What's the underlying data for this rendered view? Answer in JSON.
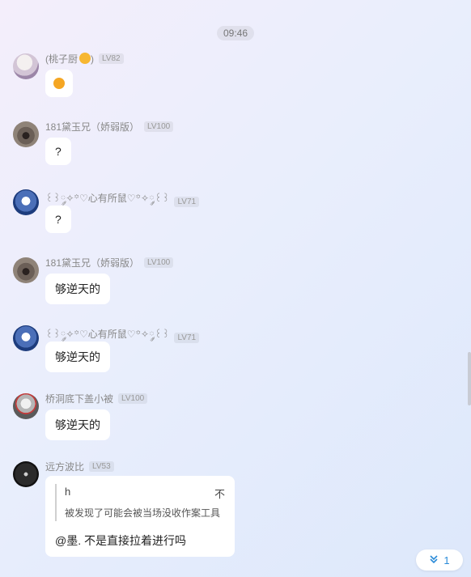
{
  "time_divider": "09:46",
  "messages": [
    {
      "name": "(桃子厨",
      "name_suffix": ")",
      "level": "LV82",
      "text": ""
    },
    {
      "name": "181黛玉兄（娇弱版）",
      "level": "LV100",
      "text": "?"
    },
    {
      "name": "꒰꒱༘✧꙳♡心有所鼠♡꙳✧༘꒰꒱",
      "level": "LV71",
      "text": "?"
    },
    {
      "name": "181黛玉兄（娇弱版）",
      "level": "LV100",
      "text": "够逆天的"
    },
    {
      "name": "꒰꒱༘✧꙳♡心有所鼠♡꙳✧༘꒰꒱",
      "level": "LV71",
      "text": "够逆天的"
    },
    {
      "name": "桥洞底下盖小被",
      "level": "LV100",
      "text": "够逆天的"
    },
    {
      "name": "远方波比",
      "level": "LV53",
      "text": "@墨. 不是直接拉着进行吗",
      "quote": {
        "author": "h",
        "text": "被发现了可能会被当场没收作案工具",
        "action": "不"
      }
    }
  ],
  "scroll_button": {
    "count": "1"
  },
  "icons": {
    "avatar_0": "anime-girl-avatar-icon",
    "avatar_1": "bird-avatar-icon",
    "avatar_2": "blue-character-avatar-icon",
    "avatar_3": "bird-avatar-icon",
    "avatar_4": "blue-character-avatar-icon",
    "avatar_5": "grey-hair-character-avatar-icon",
    "avatar_6": "dark-avatar-icon",
    "scroll": "double-chevron-down-icon"
  }
}
